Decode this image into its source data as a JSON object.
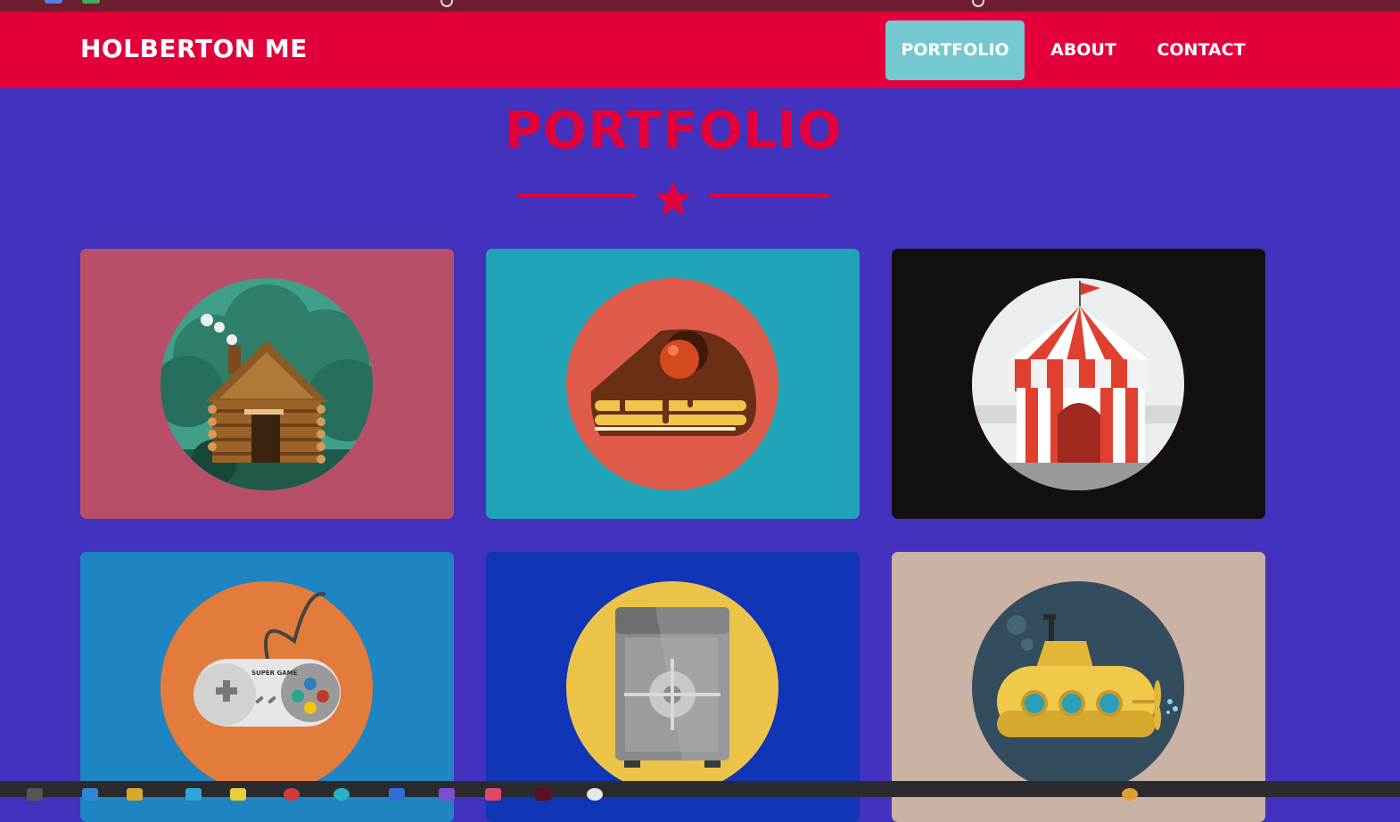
{
  "navbar": {
    "brand": "HOLBERTON ME",
    "items": [
      {
        "label": "PORTFOLIO",
        "active": true
      },
      {
        "label": "ABOUT",
        "active": false
      },
      {
        "label": "CONTACT",
        "active": false
      }
    ]
  },
  "portfolio": {
    "title": "PORTFOLIO",
    "divider_icon": "star-icon",
    "items": [
      {
        "icon": "log-cabin-icon",
        "background": "#b84f69",
        "circle": "#3f9f88"
      },
      {
        "icon": "cake-slice-icon",
        "background": "#20a3b8",
        "circle": "#e05b49"
      },
      {
        "icon": "circus-tent-icon",
        "background": "#141010",
        "circle": "#eceeee"
      },
      {
        "icon": "game-controller-icon",
        "background": "#1e84c2",
        "circle": "#e27b3b"
      },
      {
        "icon": "safe-icon",
        "background": "#1035b6",
        "circle": "#ecc349"
      },
      {
        "icon": "submarine-icon",
        "background": "#cab2a5",
        "circle": "#334c5e"
      }
    ],
    "controller_text": "SUPER GAME"
  },
  "colors": {
    "page_bg": "#4232bd",
    "navbar_bg": "#e3003a",
    "nav_active_bg": "#74c9d0",
    "accent": "#e3003a"
  }
}
